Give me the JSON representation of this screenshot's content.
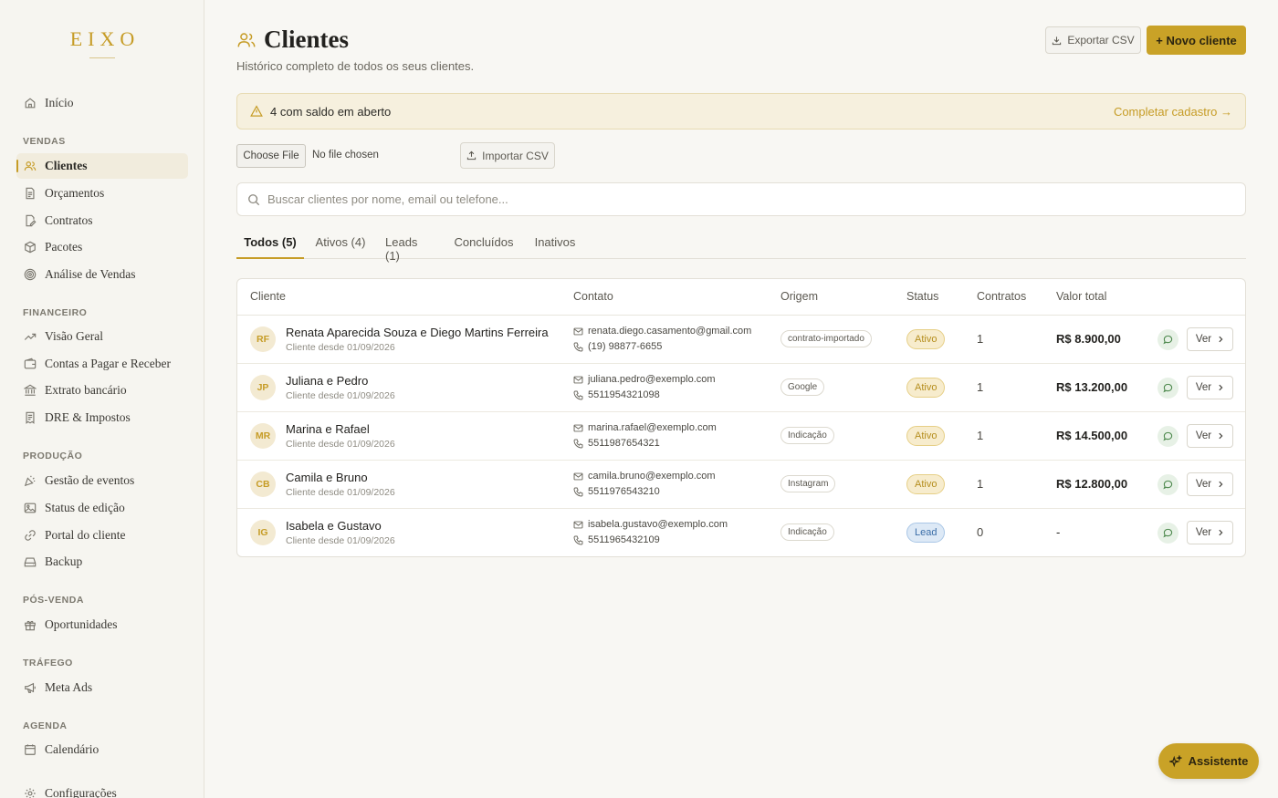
{
  "sidebar": {
    "logo": "EIXO",
    "items": [
      {
        "label": "Início"
      },
      {
        "section": "VENDAS"
      },
      {
        "label": "Clientes"
      },
      {
        "label": "Orçamentos"
      },
      {
        "label": "Contratos"
      },
      {
        "label": "Pacotes"
      },
      {
        "label": "Análise de Vendas"
      },
      {
        "section": "FINANCEIRO"
      },
      {
        "label": "Visão Geral"
      },
      {
        "label": "Contas a Pagar e Receber"
      },
      {
        "label": "Extrato bancário"
      },
      {
        "label": "DRE & Impostos"
      },
      {
        "section": "PRODUÇÃO"
      },
      {
        "label": "Gestão de eventos"
      },
      {
        "label": "Status de edição"
      },
      {
        "label": "Portal do cliente"
      },
      {
        "label": "Backup"
      },
      {
        "section": "PÓS-VENDA"
      },
      {
        "label": "Oportunidades"
      },
      {
        "section": "TRÁFEGO"
      },
      {
        "label": "Meta Ads"
      },
      {
        "section": "AGENDA"
      },
      {
        "label": "Calendário"
      },
      {
        "label": "Configurações"
      }
    ]
  },
  "header": {
    "title": "Clientes",
    "subtitle": "Histórico completo de todos os seus clientes.",
    "export_label": "Exportar CSV",
    "new_label": "+ Novo cliente"
  },
  "alert": {
    "text": "4 com saldo em aberto",
    "link": "Completar cadastro →"
  },
  "import": {
    "choose_file": "Choose File",
    "no_file": "No file chosen",
    "import_label": "Importar CSV"
  },
  "search": {
    "placeholder": "Buscar clientes por nome, email ou telefone..."
  },
  "tabs": [
    "Todos (5)",
    "Ativos (4)",
    "Leads (1)",
    "Concluídos",
    "Inativos"
  ],
  "table": {
    "columns": [
      "Cliente",
      "Contato",
      "Origem",
      "Status",
      "Contratos",
      "Valor total"
    ],
    "view_label": "Ver",
    "rows": [
      {
        "initials": "RF",
        "name": "Renata Aparecida Souza e Diego Martins Ferreira",
        "since": "Cliente desde 01/09/2026",
        "email": "renata.diego.casamento@gmail.com",
        "phone": "(19) 98877-6655",
        "origin": "contrato-importado",
        "status": "Ativo",
        "contracts": "1",
        "total": "R$ 8.900,00"
      },
      {
        "initials": "JP",
        "name": "Juliana e Pedro",
        "since": "Cliente desde 01/09/2026",
        "email": "juliana.pedro@exemplo.com",
        "phone": "5511954321098",
        "origin": "Google",
        "status": "Ativo",
        "contracts": "1",
        "total": "R$ 13.200,00"
      },
      {
        "initials": "MR",
        "name": "Marina e Rafael",
        "since": "Cliente desde 01/09/2026",
        "email": "marina.rafael@exemplo.com",
        "phone": "5511987654321",
        "origin": "Indicação",
        "status": "Ativo",
        "contracts": "1",
        "total": "R$ 14.500,00"
      },
      {
        "initials": "CB",
        "name": "Camila e Bruno",
        "since": "Cliente desde 01/09/2026",
        "email": "camila.bruno@exemplo.com",
        "phone": "5511976543210",
        "origin": "Instagram",
        "status": "Ativo",
        "contracts": "1",
        "total": "R$ 12.800,00"
      },
      {
        "initials": "IG",
        "name": "Isabela e Gustavo",
        "since": "Cliente desde 01/09/2026",
        "email": "isabela.gustavo@exemplo.com",
        "phone": "5511965432109",
        "origin": "Indicação",
        "status": "Lead",
        "contracts": "0",
        "total": "-"
      }
    ]
  },
  "assistant": {
    "label": "Assistente"
  },
  "colors": {
    "accent": "#c9a227",
    "background": "#f8f7f3",
    "lead": "#3b6ea8"
  }
}
